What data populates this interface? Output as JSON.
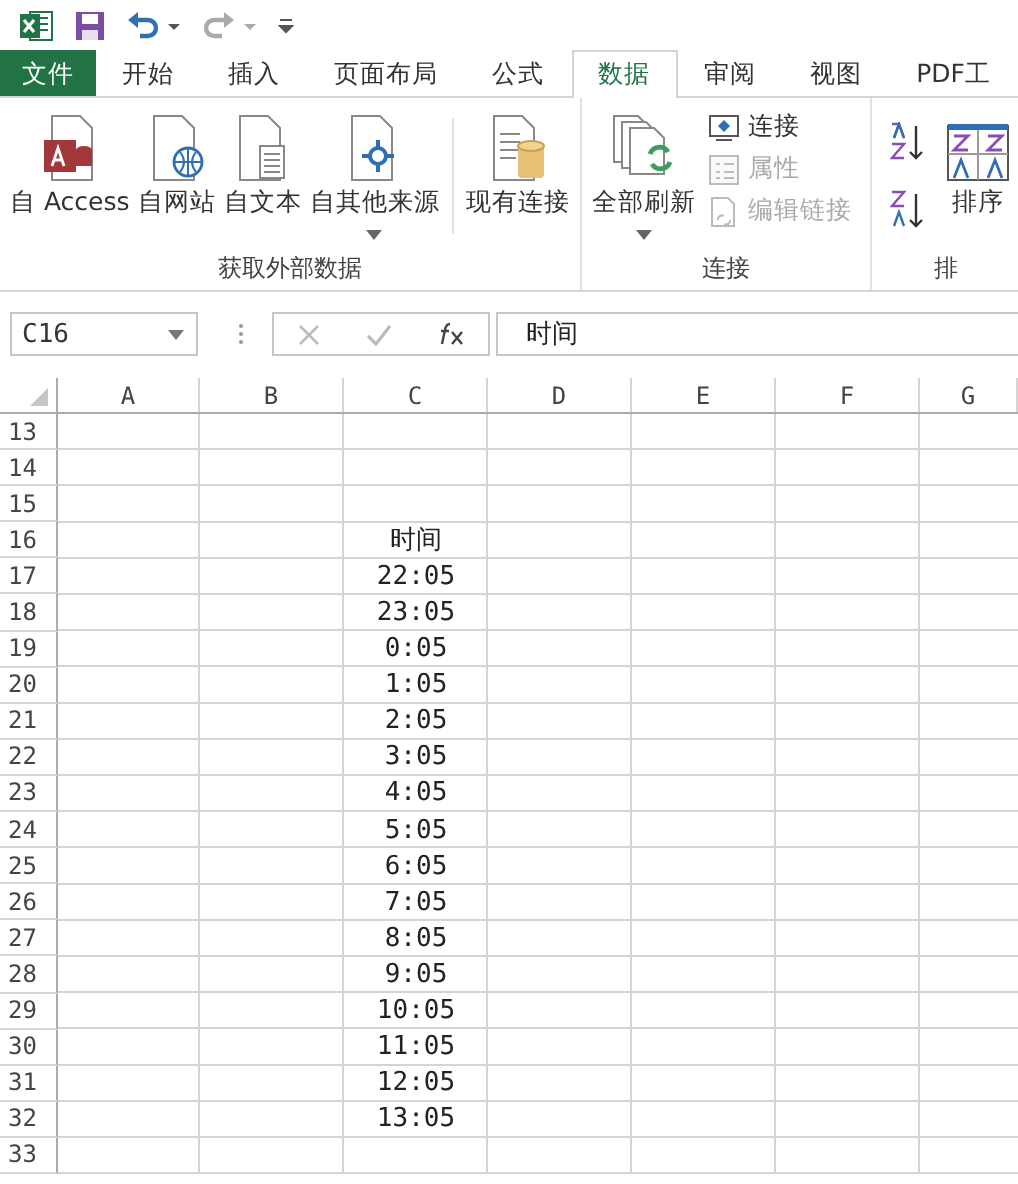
{
  "tabs": [
    {
      "label": "文件",
      "kind": "file",
      "selected": false
    },
    {
      "label": "开始",
      "kind": "tab",
      "selected": false
    },
    {
      "label": "插入",
      "kind": "tab",
      "selected": false
    },
    {
      "label": "页面布局",
      "kind": "tab",
      "selected": false
    },
    {
      "label": "公式",
      "kind": "tab",
      "selected": false
    },
    {
      "label": "数据",
      "kind": "tab",
      "selected": true
    },
    {
      "label": "审阅",
      "kind": "tab",
      "selected": false
    },
    {
      "label": "视图",
      "kind": "tab",
      "selected": false
    },
    {
      "label": "PDF工",
      "kind": "tab",
      "selected": false
    }
  ],
  "ribbon": [
    {
      "label": "获取外部数据",
      "items": [
        {
          "label": "自 Access",
          "kind": "large",
          "dropdown": false
        },
        {
          "label": "自网站",
          "kind": "large",
          "dropdown": false
        },
        {
          "label": "自文本",
          "kind": "large",
          "dropdown": false
        },
        {
          "label": "自其他来源",
          "kind": "large",
          "dropdown": true
        },
        {
          "kind": "separator"
        },
        {
          "label": "现有连接",
          "kind": "large",
          "dropdown": false
        }
      ]
    },
    {
      "label": "连接",
      "items": [
        {
          "label": "全部刷新",
          "kind": "large",
          "dropdown": true
        },
        {
          "kind": "stack",
          "items": [
            {
              "label": "连接",
              "disabled": false
            },
            {
              "label": "属性",
              "disabled": true
            },
            {
              "label": "编辑链接",
              "disabled": true
            }
          ]
        }
      ]
    },
    {
      "label": "排",
      "items": [
        {
          "kind": "sortpair"
        },
        {
          "label": "排序",
          "kind": "large",
          "dropdown": false
        }
      ]
    }
  ],
  "name_box": "C16",
  "formula": "时间",
  "columns": [
    "A",
    "B",
    "C",
    "D",
    "E",
    "F",
    "G"
  ],
  "rows": [
    {
      "number": "13",
      "c": ""
    },
    {
      "number": "14",
      "c": ""
    },
    {
      "number": "15",
      "c": ""
    },
    {
      "number": "16",
      "c": "时间"
    },
    {
      "number": "17",
      "c": "22:05"
    },
    {
      "number": "18",
      "c": "23:05"
    },
    {
      "number": "19",
      "c": "0:05"
    },
    {
      "number": "20",
      "c": "1:05"
    },
    {
      "number": "21",
      "c": "2:05"
    },
    {
      "number": "22",
      "c": "3:05"
    },
    {
      "number": "23",
      "c": "4:05"
    },
    {
      "number": "24",
      "c": "5:05"
    },
    {
      "number": "25",
      "c": "6:05"
    },
    {
      "number": "26",
      "c": "7:05"
    },
    {
      "number": "27",
      "c": "8:05"
    },
    {
      "number": "28",
      "c": "9:05"
    },
    {
      "number": "29",
      "c": "10:05"
    },
    {
      "number": "30",
      "c": "11:05"
    },
    {
      "number": "31",
      "c": "12:05"
    },
    {
      "number": "32",
      "c": "13:05"
    },
    {
      "number": "33",
      "c": ""
    }
  ]
}
